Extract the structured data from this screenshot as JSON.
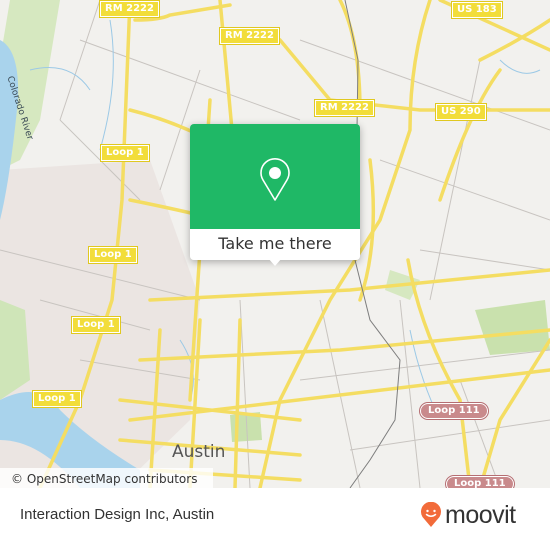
{
  "map": {
    "attribution": "© OpenStreetMap contributors",
    "city_label": "Austin",
    "river_label": "Colorado River",
    "road_labels": [
      {
        "id": "rm2222-a",
        "text": "RM 2222",
        "type": "highway"
      },
      {
        "id": "rm2222-b",
        "text": "RM 2222",
        "type": "highway"
      },
      {
        "id": "rm2222-c",
        "text": "RM 2222",
        "type": "highway"
      },
      {
        "id": "us183",
        "text": "US 183",
        "type": "highway"
      },
      {
        "id": "us290",
        "text": "US 290",
        "type": "highway"
      },
      {
        "id": "loop1-a",
        "text": "Loop 1",
        "type": "highway"
      },
      {
        "id": "loop1-b",
        "text": "Loop 1",
        "type": "highway"
      },
      {
        "id": "loop1-c",
        "text": "Loop 1",
        "type": "highway"
      },
      {
        "id": "loop1-d",
        "text": "Loop 1",
        "type": "highway"
      },
      {
        "id": "loop111-a",
        "text": "Loop 111",
        "type": "loop"
      },
      {
        "id": "loop111-b",
        "text": "Loop 111",
        "type": "loop"
      }
    ]
  },
  "popup": {
    "icon": "map-pin-icon",
    "button_label": "Take me there",
    "color": "#1fb866"
  },
  "footer": {
    "place_name": "Interaction Design Inc, Austin",
    "brand": "moovit",
    "brand_color": "#f26b3a"
  }
}
